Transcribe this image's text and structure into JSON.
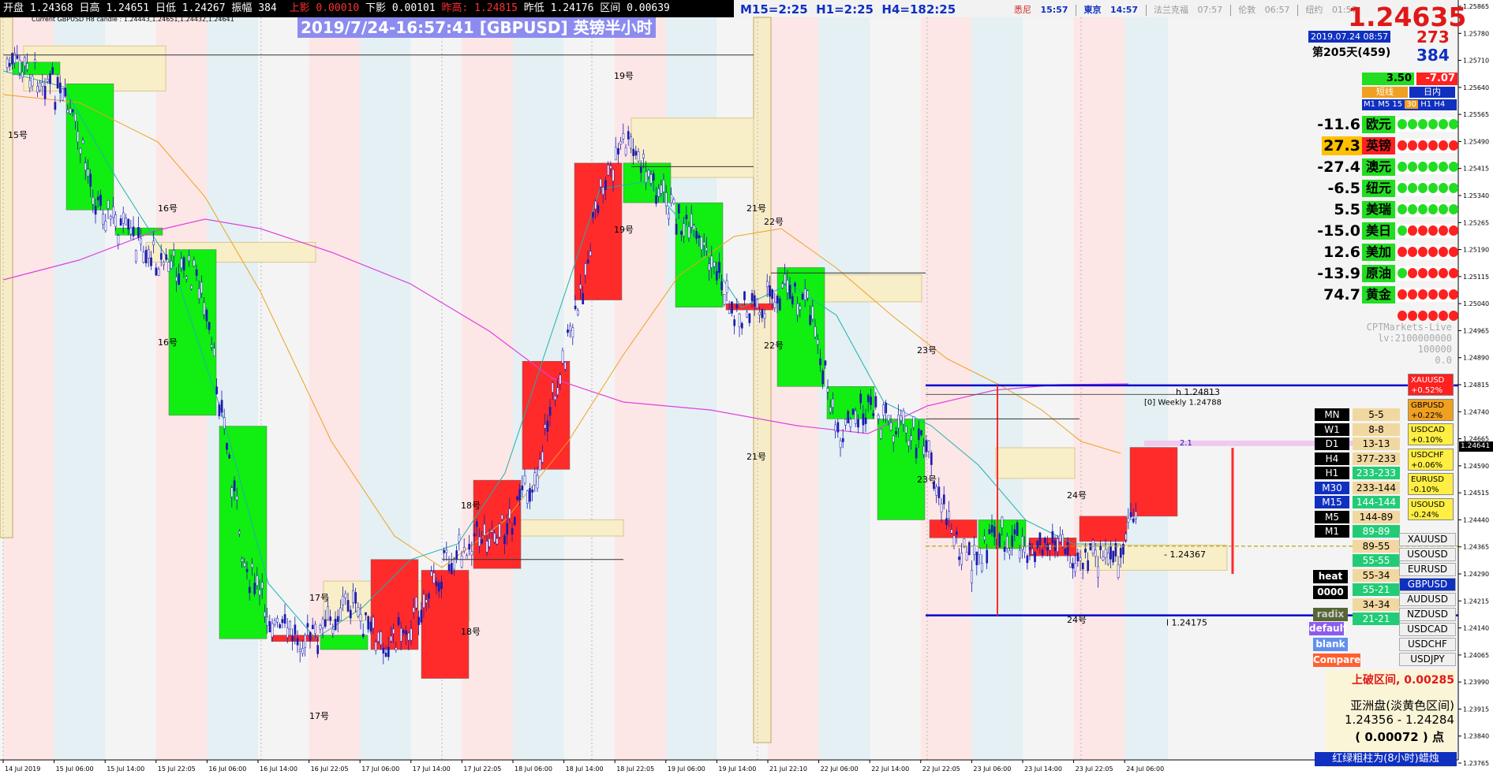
{
  "top_bar": {
    "open_label": "开盘",
    "open": "1.24368",
    "high_label": "日高",
    "high": "1.24651",
    "low_label": "日低",
    "low": "1.24267",
    "amp_label": "振幅",
    "amp": "384",
    "upper_shadow_label": "上影",
    "upper_shadow": "0.00010",
    "lower_shadow_label": "下影",
    "lower_shadow": "0.00101",
    "prev_high_label": "昨高:",
    "prev_high": "1.24815",
    "prev_low_label": "昨低",
    "prev_low": "1.24176",
    "range_label": "区间",
    "range": "0.00639",
    "timeframes": "M15=2:25  H1=2:25  H4=182:25",
    "subtitle": "Current GBPUSD H8 candle : 1.24443,1.24651,1.24432,1.24641"
  },
  "clocks": [
    {
      "city": "悉尼",
      "time": "15:57"
    },
    {
      "city": "東京",
      "time": "14:57"
    },
    {
      "city": "法兰克福",
      "time": "07:57"
    },
    {
      "city": "伦敦",
      "time": "06:57"
    },
    {
      "city": "纽约",
      "time": "01:57"
    }
  ],
  "banner": "2019/7/24-16:57:41 [GBPUSD] 英镑半小时",
  "price_box": {
    "price": "1.24635",
    "date": "2019.07.24 08:57",
    "num1": "273",
    "num2": "384",
    "day_label": "第205天(459)",
    "green_val": "3.50",
    "red_val": "-7.07",
    "tab1": "短线",
    "tab2": "日内",
    "tf_labels": [
      "M1",
      "M5",
      "15",
      "30",
      "H1",
      "H4"
    ]
  },
  "strength": [
    {
      "value": "-11.6",
      "name": "欧元",
      "dots": "gggggg"
    },
    {
      "value": "27.3",
      "name": "英镑",
      "dots": "rrrrrr",
      "highlight": true
    },
    {
      "value": "-27.4",
      "name": "澳元",
      "dots": "gggggg"
    },
    {
      "value": "-6.5",
      "name": "纽元",
      "dots": "gggggg"
    },
    {
      "value": "5.5",
      "name": "美瑞",
      "dots": "gggggg"
    },
    {
      "value": "-15.0",
      "name": "美日",
      "dots": "grrrrr"
    },
    {
      "value": "12.6",
      "name": "美加",
      "dots": "rrrrrr"
    },
    {
      "value": "-13.9",
      "name": "原油",
      "dots": "grrrrr"
    },
    {
      "value": "74.7",
      "name": "黄金",
      "dots": "rrrrrr"
    }
  ],
  "broker": [
    "CPTMarkets-Live",
    "lv:2100000000",
    "100000",
    "0.0"
  ],
  "tf_rows": [
    {
      "tf": "MN",
      "range": "5-5"
    },
    {
      "tf": "W1",
      "range": "8-8"
    },
    {
      "tf": "D1",
      "range": "13-13"
    },
    {
      "tf": "H4",
      "range": "377-233"
    },
    {
      "tf": "H1",
      "range": "233-233"
    },
    {
      "tf": "M30",
      "range": "233-144"
    },
    {
      "tf": "M15",
      "range": "144-144"
    },
    {
      "tf": "M5",
      "range": "144-89"
    },
    {
      "tf": "M1",
      "range": "89-89"
    }
  ],
  "extra_ranges": [
    "89-55",
    "55-55",
    "55-34",
    "55-21",
    "34-34",
    "21-21"
  ],
  "pair_changes": [
    {
      "pair": "XAUUSD",
      "chg": "+0.52%"
    },
    {
      "pair": "GBPUSD",
      "chg": "+0.22%"
    },
    {
      "pair": "USDCAD",
      "chg": "+0.10%"
    },
    {
      "pair": "USDCHF",
      "chg": "+0.06%"
    },
    {
      "pair": "EURUSD",
      "chg": "-0.10%"
    },
    {
      "pair": "USOUSD",
      "chg": "-0.24%"
    }
  ],
  "pair_buttons": [
    "XAUUSD",
    "USOUSD",
    "EURUSD",
    "GBPUSD",
    "AUDUSD",
    "NZDUSD",
    "USDCAD",
    "USDCHF",
    "USDJPY"
  ],
  "mode_buttons": [
    "heat",
    "0000",
    "radix",
    "default",
    "blank",
    "Compare"
  ],
  "info": {
    "line1": "上破区间, 0.00285",
    "line2": "亚洲盘(淡黄色区间)",
    "line3": "1.24356 - 1.24284",
    "line4": "( 0.00072 ) 点",
    "line5": "红绿粗柱为(8小时)蜡烛"
  },
  "chart_labels": {
    "h_label": "h  1.24813",
    "weekly": "[0] Weekly 1.24788",
    "current": "2.1",
    "mid_label": "-  1.24367",
    "low_label": "l  1.24175",
    "day_marks": [
      "15号",
      "16号",
      "16号",
      "17号",
      "17号",
      "18号",
      "18号",
      "19号",
      "19号",
      "21号",
      "21号",
      "22号",
      "22号",
      "23号",
      "23号",
      "24号",
      "24号"
    ]
  },
  "price_axis": [
    "1.25865",
    "1.25780",
    "1.25710",
    "1.25640",
    "1.25565",
    "1.25490",
    "1.25415",
    "1.25340",
    "1.25265",
    "1.25190",
    "1.25115",
    "1.25040",
    "1.24965",
    "1.24890",
    "1.24815",
    "1.24740",
    "1.24665",
    "1.24590",
    "1.24515",
    "1.24440",
    "1.24365",
    "1.24290",
    "1.24215",
    "1.24140",
    "1.24065",
    "1.23990",
    "1.23915",
    "1.23840",
    "1.23765"
  ],
  "current_price_tag": "1.24641",
  "time_axis": [
    "14 Jul 2019",
    "15 Jul 06:00",
    "15 Jul 14:00",
    "15 Jul 22:05",
    "16 Jul 06:00",
    "16 Jul 14:00",
    "16 Jul 22:05",
    "17 Jul 06:00",
    "17 Jul 14:00",
    "17 Jul 22:05",
    "18 Jul 06:00",
    "18 Jul 14:00",
    "18 Jul 22:05",
    "19 Jul 06:00",
    "19 Jul 14:00",
    "21 Jul 22:10",
    "22 Jul 06:00",
    "22 Jul 14:00",
    "22 Jul 22:05",
    "23 Jul 06:00",
    "23 Jul 14:00",
    "23 Jul 22:05",
    "24 Jul 06:00"
  ],
  "colors": {
    "up": "#ff2b2b",
    "down": "#11ee11",
    "ma_purple": "#e040e0",
    "ma_orange": "#f0a020",
    "ma_teal": "#20b0b0",
    "blue_line": "#0000cc"
  }
}
